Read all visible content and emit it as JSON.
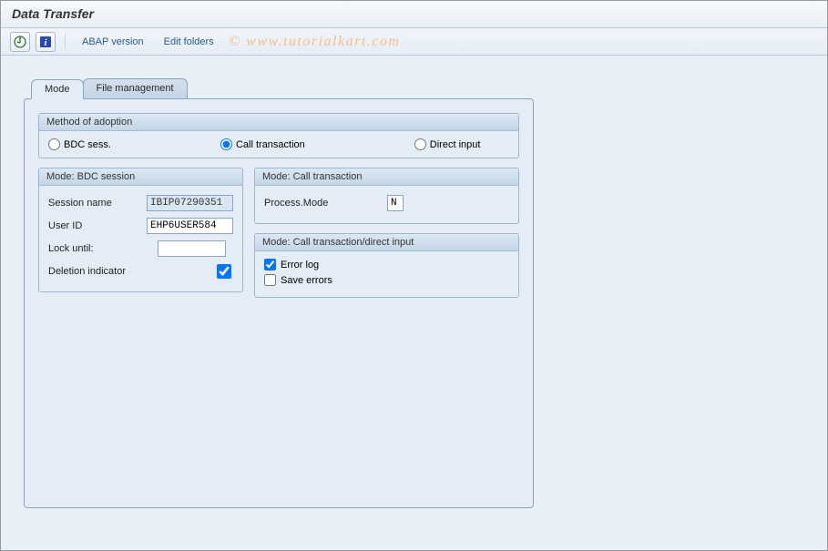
{
  "title": "Data Transfer",
  "watermark": "©  www.tutorialkart.com",
  "toolbar": {
    "abap_version": "ABAP version",
    "edit_folders": "Edit folders"
  },
  "tabs": {
    "mode": "Mode",
    "file_mgmt": "File management"
  },
  "group_adoption": {
    "title": "Method of adoption",
    "bdc_sess": "BDC sess.",
    "call_trans": "Call transaction",
    "direct_input": "Direct input"
  },
  "group_bdc": {
    "title": "Mode: BDC session",
    "session_name_label": "Session name",
    "session_name_value": "IBIP07290351",
    "user_id_label": "User ID",
    "user_id_value": "EHP6USER584",
    "lock_until_label": "Lock until:",
    "lock_until_value": "",
    "deletion_label": "Deletion indicator"
  },
  "group_calltrans": {
    "title": "Mode: Call transaction",
    "process_mode_label": "Process.Mode",
    "process_mode_value": "N"
  },
  "group_errors": {
    "title": "Mode: Call transaction/direct input",
    "error_log": "Error log",
    "save_errors": "Save errors"
  }
}
